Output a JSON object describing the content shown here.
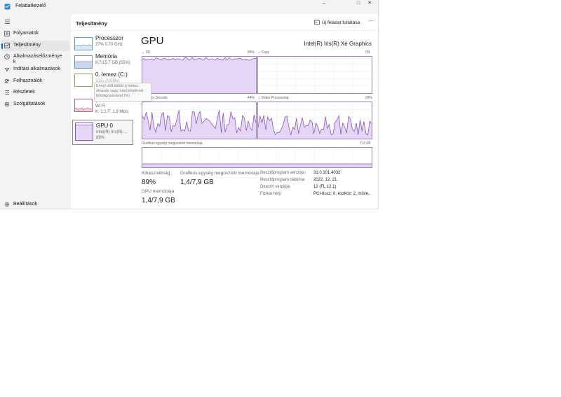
{
  "window": {
    "title": "Feladatkezelő",
    "minimize": "–",
    "maximize": "□",
    "close": "✕"
  },
  "sidebar": {
    "items": [
      {
        "label": "Folyamatok",
        "icon": "processes-icon"
      },
      {
        "label": "Teljesítmény",
        "icon": "performance-icon"
      },
      {
        "label": "Alkalmazáselőzménye\nk",
        "icon": "history-icon"
      },
      {
        "label": "Indítási alkalmazások",
        "icon": "startup-icon"
      },
      {
        "label": "Felhasználók",
        "icon": "users-icon"
      },
      {
        "label": "Részletek",
        "icon": "details-icon"
      },
      {
        "label": "Szolgáltatások",
        "icon": "services-icon"
      }
    ],
    "settings": "Beállítások"
  },
  "header": {
    "title": "Teljesítmény",
    "run_task": "Új feladat futtatása",
    "more": "···"
  },
  "tiles": [
    {
      "title": "Processzor",
      "sub1": "27% 0,70 GHz",
      "sub2": ""
    },
    {
      "title": "Memória",
      "sub1": "8,7/15,7 GB (55%)",
      "sub2": ""
    },
    {
      "title": "0. lemez (C:)",
      "sub1": "SSD (NVMe)",
      "sub2": ""
    },
    {
      "title": "Wi-Fi",
      "sub1": "Wi-Fi",
      "sub2": "K: 1,1 F: 1,9 Mb/s"
    },
    {
      "title": "GPU 0",
      "sub1": "Intel(R) Iris(R) ...",
      "sub2": "89%"
    }
  ],
  "tooltip": "Ennyi időt töltött a lemez olvasás vagy írási kérelmek feldolgozásával (%)",
  "gpu": {
    "title": "GPU",
    "model": "Intel(R) Iris(R) Xe Graphics",
    "engines": [
      {
        "name": "3D",
        "value": "89%"
      },
      {
        "name": "Copy",
        "value": "0%"
      },
      {
        "name": "Video Decode",
        "value": "44%"
      },
      {
        "name": "Video Processing",
        "value": "29%"
      }
    ],
    "shared_label": "Grafikus egység megosztott memóriája",
    "shared_max": "7,9 GB",
    "stats": {
      "usage_label": "Kihasználtság",
      "usage_value": "89%",
      "shared_label": "Grafikus egység megosztott memóriája",
      "shared_value": "1,4/7,9 GB",
      "gpu_mem_label": "GPU memóriája",
      "gpu_mem_value": "1,4/7,9 GB"
    },
    "info": [
      {
        "key": "Illesztőprogram verziója:",
        "value": "31.0.101.4032"
      },
      {
        "key": "Illesztőprogram dátuma:",
        "value": "2022. 12. 21."
      },
      {
        "key": "DirectX verziója:",
        "value": "12 (FL 12.1)"
      },
      {
        "key": "Fizikai hely:",
        "value": "PCI-busz: 0, eszköz: 2, műve..."
      }
    ]
  },
  "colors": {
    "accent": "#0067c0",
    "gpu_line": "#8a56c2",
    "gpu_fill": "#e6d6f5",
    "grid": "#ececec"
  }
}
